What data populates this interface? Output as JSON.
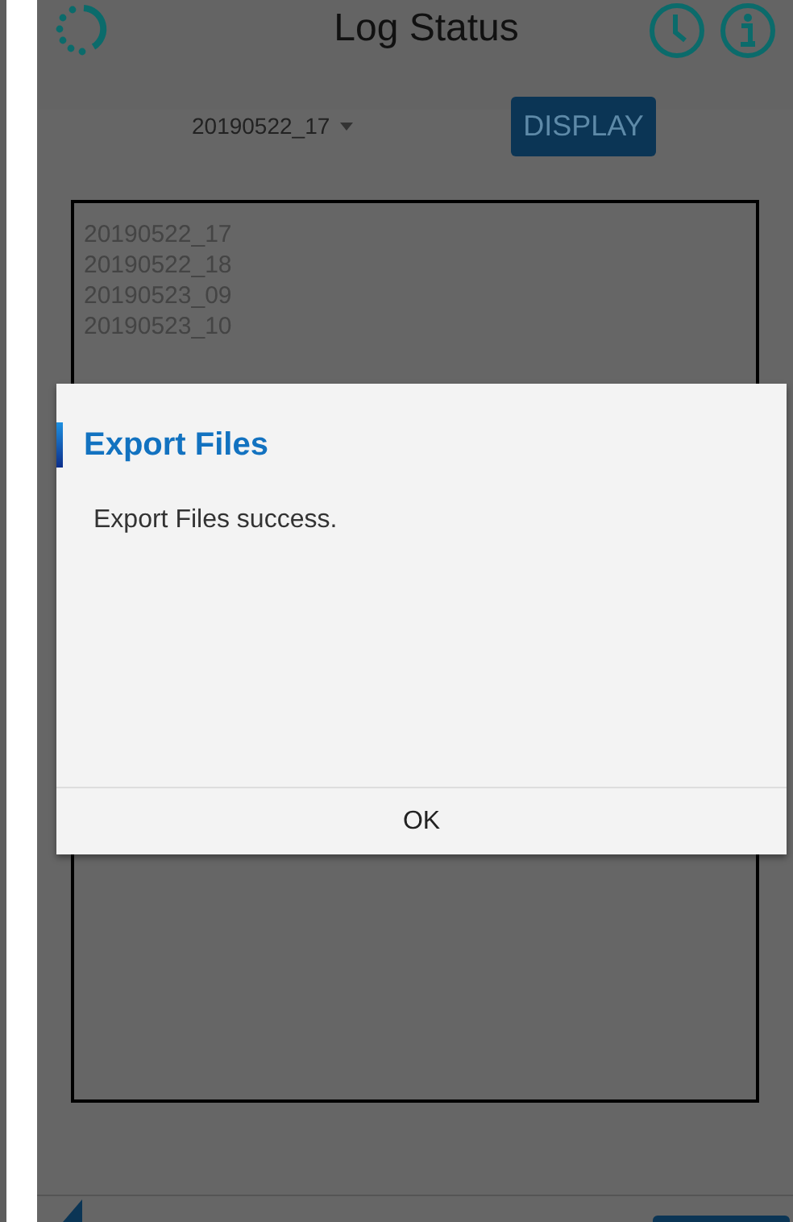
{
  "header": {
    "title": "Log Status"
  },
  "selector": {
    "value": "20190522_17",
    "button": "DISPLAY"
  },
  "log_list": [
    "20190522_17",
    "20190522_18",
    "20190523_09",
    "20190523_10"
  ],
  "dialog": {
    "title": "Export Files",
    "message": "Export Files success.",
    "button": "OK"
  }
}
